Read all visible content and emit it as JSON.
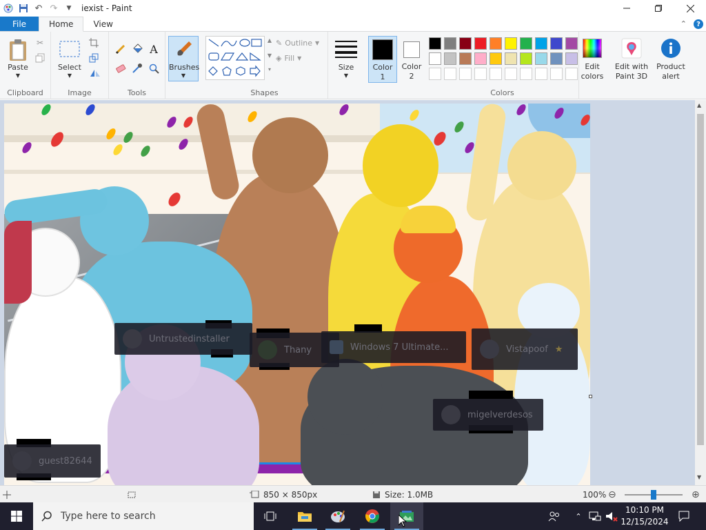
{
  "window": {
    "title": "iexist - Paint"
  },
  "tabs": {
    "file": "File",
    "home": "Home",
    "view": "View"
  },
  "ribbon": {
    "clipboard": {
      "paste": "Paste",
      "group": "Clipboard"
    },
    "image": {
      "select": "Select",
      "group": "Image"
    },
    "tools": {
      "group": "Tools"
    },
    "brushes": {
      "label": "Brushes"
    },
    "shapes": {
      "outline": "Outline",
      "fill": "Fill",
      "group": "Shapes"
    },
    "size": {
      "label": "Size"
    },
    "color1": {
      "label": "Color",
      "num": "1",
      "color": "#000000"
    },
    "color2": {
      "label": "Color",
      "num": "2",
      "color": "#ffffff"
    },
    "colors": {
      "group": "Colors",
      "row1": [
        "#000000",
        "#7f7f7f",
        "#880015",
        "#ed1c24",
        "#ff7f27",
        "#fff200",
        "#22b14c",
        "#00a2e8",
        "#3f48cc",
        "#a349a4"
      ],
      "row2": [
        "#ffffff",
        "#c3c3c3",
        "#b97a57",
        "#ffaec9",
        "#ffc90e",
        "#efe4b0",
        "#b5e61d",
        "#99d9ea",
        "#7092be",
        "#c8bfe7"
      ]
    },
    "edit_colors": {
      "line1": "Edit",
      "line2": "colors"
    },
    "paint3d": {
      "line1": "Edit with",
      "line2": "Paint 3D"
    },
    "product_alert": {
      "line1": "Product",
      "line2": "alert"
    }
  },
  "overlays": {
    "u1": "Untrustedinstaller",
    "u2": "Thany",
    "u3": "Windows 7 Ultimate...",
    "u4": "Vistapoof",
    "u5": "migelverdesos",
    "u6": "guest82644"
  },
  "status": {
    "dimensions": "850 × 850px",
    "size": "Size: 1.0MB",
    "zoom": "100%"
  },
  "taskbar": {
    "search_placeholder": "Type here to search",
    "time": "10:10 PM",
    "date": "12/15/2024"
  }
}
